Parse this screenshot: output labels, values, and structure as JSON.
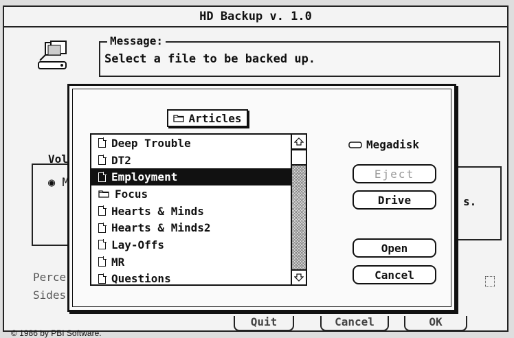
{
  "window": {
    "title": "HD Backup v. 1.0"
  },
  "message": {
    "legend": "Message:",
    "text": "Select a file to be backed up."
  },
  "background": {
    "vol_label": "Vol",
    "radio_label": "M",
    "s_label": "s.",
    "perce_label": "Perce",
    "sides_label": "Sides",
    "quit_label": "Quit",
    "cancel_label": "Cancel",
    "ok_label": "OK",
    "copyright": "© 1986 by PBI Software."
  },
  "dialog": {
    "folder": "Articles",
    "drive_name": "Megadisk",
    "files": [
      {
        "name": "Deep Trouble",
        "icon": "document-icon",
        "selected": false
      },
      {
        "name": "DT2",
        "icon": "document-icon",
        "selected": false
      },
      {
        "name": "Employment",
        "icon": "document-icon",
        "selected": true
      },
      {
        "name": "Focus",
        "icon": "folder-icon",
        "selected": false
      },
      {
        "name": "Hearts & Minds",
        "icon": "document-icon",
        "selected": false
      },
      {
        "name": "Hearts & Minds2",
        "icon": "document-icon",
        "selected": false
      },
      {
        "name": "Lay-Offs",
        "icon": "document-icon",
        "selected": false
      },
      {
        "name": "MR",
        "icon": "document-icon",
        "selected": false
      },
      {
        "name": "Questions",
        "icon": "document-icon",
        "selected": false
      }
    ],
    "buttons": {
      "eject": "Eject",
      "drive": "Drive",
      "open": "Open",
      "cancel": "Cancel"
    }
  }
}
